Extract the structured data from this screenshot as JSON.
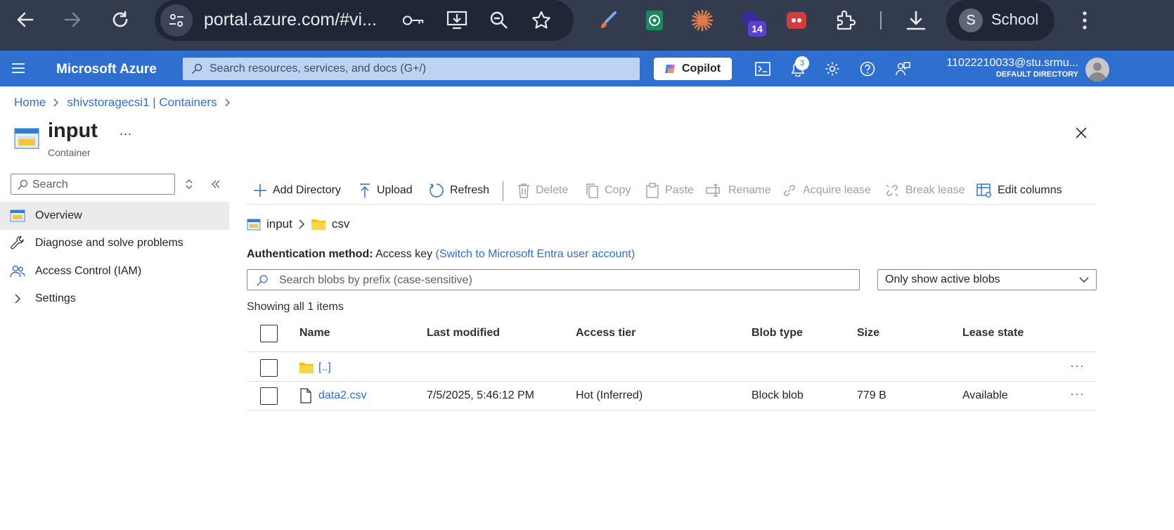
{
  "browser": {
    "url": "portal.azure.com/#vi...",
    "profile_initial": "S",
    "profile_name": "School",
    "ext_badge": "14"
  },
  "azure": {
    "brand": "Microsoft Azure",
    "search_placeholder": "Search resources, services, and docs (G+/)",
    "copilot_label": "Copilot",
    "notifications_count": "3",
    "account_email": "11022210033@stu.srmu...",
    "account_directory": "DEFAULT DIRECTORY"
  },
  "breadcrumb": {
    "home": "Home",
    "parent": "shivstoragecsi1 | Containers"
  },
  "header": {
    "title": "input",
    "subtitle": "Container",
    "more": "..."
  },
  "sidebar": {
    "search_placeholder": "Search",
    "items": [
      {
        "label": "Overview"
      },
      {
        "label": "Diagnose and solve problems"
      },
      {
        "label": "Access Control (IAM)"
      },
      {
        "label": "Settings"
      }
    ]
  },
  "toolbar": {
    "add_directory": "Add Directory",
    "upload": "Upload",
    "refresh": "Refresh",
    "delete": "Delete",
    "copy": "Copy",
    "paste": "Paste",
    "rename": "Rename",
    "acquire_lease": "Acquire lease",
    "break_lease": "Break lease",
    "edit_columns": "Edit columns"
  },
  "path": {
    "container": "input",
    "folder": "csv"
  },
  "auth": {
    "label": "Authentication method:",
    "value": "Access key",
    "switch_link": "(Switch to Microsoft Entra user account)"
  },
  "blob_search_placeholder": "Search blobs by prefix (case-sensitive)",
  "filter_selected": "Only show active blobs",
  "showing_text": "Showing all 1 items",
  "table": {
    "headers": [
      "Name",
      "Last modified",
      "Access tier",
      "Blob type",
      "Size",
      "Lease state"
    ],
    "rows": [
      {
        "name": "[..]",
        "modified": "",
        "tier": "",
        "type": "",
        "size": "",
        "lease": ""
      },
      {
        "name": "data2.csv",
        "modified": "7/5/2025, 5:46:12 PM",
        "tier": "Hot (Inferred)",
        "type": "Block blob",
        "size": "779 B",
        "lease": "Available"
      }
    ],
    "row_more": "···"
  }
}
